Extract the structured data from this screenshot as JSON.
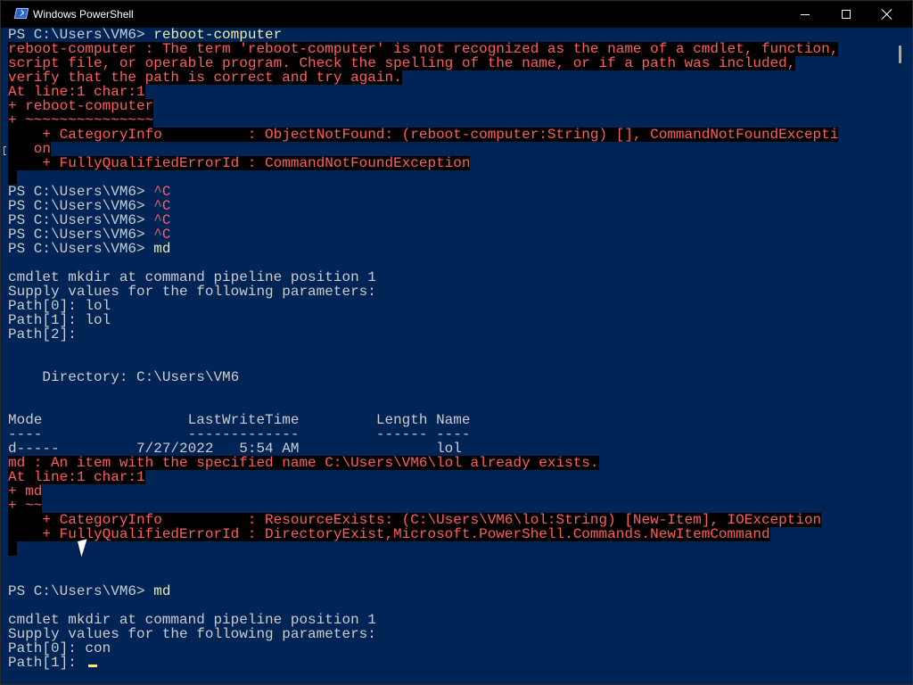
{
  "window": {
    "title": "Windows PowerShell",
    "icon": "powershell-icon",
    "controls": [
      "minimize-icon",
      "maximize-icon",
      "close-icon"
    ]
  },
  "colors": {
    "console_background": "#012456",
    "titlebar": "#000000",
    "normal_text": "#cccccc",
    "error_text": "#ff5e5e",
    "error_background": "#000000",
    "command_text": "#eaeaaa",
    "cursor": "#ffe67a"
  },
  "console": {
    "lines": [
      "PS C:\\Users\\VM6> reboot-computer",
      "reboot-computer : The term 'reboot-computer' is not recognized as the name of a cmdlet, function,",
      "script file, or operable program. Check the spelling of the name, or if a path was included,",
      "verify that the path is correct and try again.",
      "At line:1 char:1",
      "+ reboot-computer",
      "+ ~~~~~~~~~~~~~~~",
      "    + CategoryInfo          : ObjectNotFound: (reboot-computer:String) [], CommandNotFoundExcepti",
      "   on",
      "    + FullyQualifiedErrorId : CommandNotFoundException",
      "",
      "PS C:\\Users\\VM6> ^C",
      "PS C:\\Users\\VM6> ^C",
      "PS C:\\Users\\VM6> ^C",
      "PS C:\\Users\\VM6> ^C",
      "PS C:\\Users\\VM6> md",
      "",
      "cmdlet mkdir at command pipeline position 1",
      "Supply values for the following parameters:",
      "Path[0]: lol",
      "Path[1]: lol",
      "Path[2]:",
      "",
      "",
      "    Directory: C:\\Users\\VM6",
      "",
      "",
      "Mode                 LastWriteTime         Length Name",
      "----                 -------------         ------ ----",
      "d-----         7/27/2022   5:54 AM                lol",
      "md : An item with the specified name C:\\Users\\VM6\\lol already exists.",
      "At line:1 char:1",
      "+ md",
      "+ ~~",
      "    + CategoryInfo          : ResourceExists: (C:\\Users\\VM6\\lol:String) [New-Item], IOException",
      "    + FullyQualifiedErrorId : DirectoryExist,Microsoft.PowerShell.Commands.NewItemCommand",
      "",
      "",
      "",
      "",
      "PS C:\\Users\\VM6> md",
      "",
      "cmdlet mkdir at command pipeline position 1",
      "Supply values for the following parameters:",
      "Path[0]: con",
      "Path[1]:"
    ],
    "commands": [
      "reboot-computer",
      "^C",
      "^C",
      "^C",
      "^C",
      "md",
      "md"
    ]
  }
}
